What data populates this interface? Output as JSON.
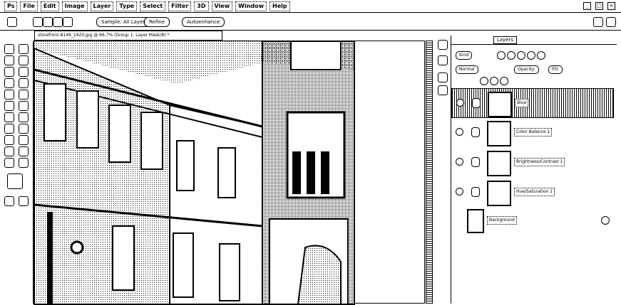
{
  "menubar": {
    "items": [
      "Ps",
      "File",
      "Edit",
      "Image",
      "Layer",
      "Type",
      "Select",
      "Filter",
      "3D",
      "View",
      "Window",
      "Help"
    ],
    "controls": [
      "_",
      "□",
      "×"
    ]
  },
  "options_bar": {
    "sample_label": "Sample: All Layers",
    "refine_label": "Refine",
    "ai_label": "Autoenhance"
  },
  "document": {
    "tab_title": "storefront-8146_1920.jpg @ 66.7% (Group 1, Layer Mask/8) *"
  },
  "layers_panel": {
    "tab_label": "Layers",
    "kind_label": "Kind",
    "blend_mode": "Normal",
    "opacity_label": "Opacity:",
    "fill_label": "Fill:",
    "layers": [
      {
        "name": "Blue",
        "selected": true
      },
      {
        "name": "Color Balance 1",
        "selected": false
      },
      {
        "name": "Brightness/Contrast 1",
        "selected": false
      },
      {
        "name": "Hue/Saturation 1",
        "selected": false
      }
    ],
    "background_label": "Background"
  }
}
